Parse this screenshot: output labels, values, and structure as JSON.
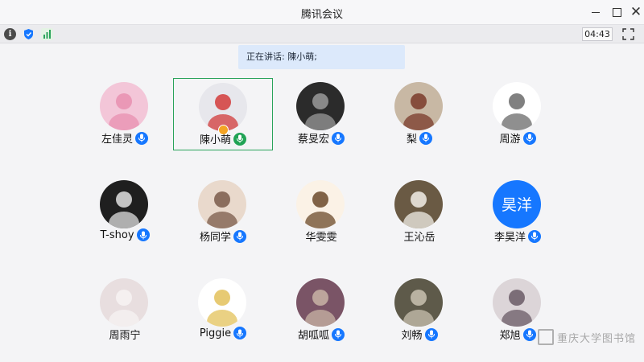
{
  "app": {
    "title": "腾讯会议"
  },
  "toolbar": {
    "timer": "04:43"
  },
  "speaking": {
    "text": "正在讲话: 陳小萌;"
  },
  "participants": [
    {
      "name": "左佳灵",
      "mic": "blue",
      "bg": "#f3c6d8",
      "fg": "#e88fb0"
    },
    {
      "name": "陳小萌",
      "mic": "green",
      "bg": "#e7e7ec",
      "fg": "#d23b3b",
      "active": true,
      "host": true
    },
    {
      "name": "蔡旻宏",
      "mic": "blue",
      "bg": "#2b2b2b",
      "fg": "#9a9a9a"
    },
    {
      "name": "梨",
      "mic": "blue",
      "bg": "#c8b8a4",
      "fg": "#7a3a2a"
    },
    {
      "name": "周游",
      "mic": "blue",
      "bg": "#ffffff",
      "fg": "#6a6a6a"
    },
    {
      "name": "T-shoy",
      "mic": "blue",
      "bg": "#1f1f1f",
      "fg": "#e0e0e0"
    },
    {
      "name": "杨同学",
      "mic": "blue",
      "bg": "#e9d9cc",
      "fg": "#7a5a4a"
    },
    {
      "name": "华雯雯",
      "mic": "none",
      "bg": "#fbf2e6",
      "fg": "#6b4a2a"
    },
    {
      "name": "王沁岳",
      "mic": "none",
      "bg": "#6a5a44",
      "fg": "#f2efe7"
    },
    {
      "name": "李昊洋",
      "mic": "blue",
      "bg": "#1677ff",
      "fg": "#ffffff",
      "initials": "昊洋"
    },
    {
      "name": "周雨宁",
      "mic": "none",
      "bg": "#e8dedf",
      "fg": "#f7f3f3"
    },
    {
      "name": "Piggie",
      "mic": "blue",
      "bg": "#ffffff",
      "fg": "#e3c15a"
    },
    {
      "name": "胡呱呱",
      "mic": "blue",
      "bg": "#7a5466",
      "fg": "#c9b4a6"
    },
    {
      "name": "刘畅",
      "mic": "blue",
      "bg": "#5e5a4a",
      "fg": "#c9c2b0"
    },
    {
      "name": "郑旭",
      "mic": "blue",
      "bg": "#dcd5d8",
      "fg": "#6a5a66"
    }
  ],
  "watermark": {
    "text": "重庆大学图书馆"
  },
  "icons": {
    "info": "info-icon",
    "shield": "shield-icon",
    "signal": "signal-icon",
    "fullscreen": "fullscreen-icon",
    "mic": "microphone-icon",
    "host": "host-badge-icon"
  },
  "colors": {
    "accent": "#1677ff",
    "speaking_bg": "#dce9fb",
    "active_border": "#2aa35a"
  }
}
